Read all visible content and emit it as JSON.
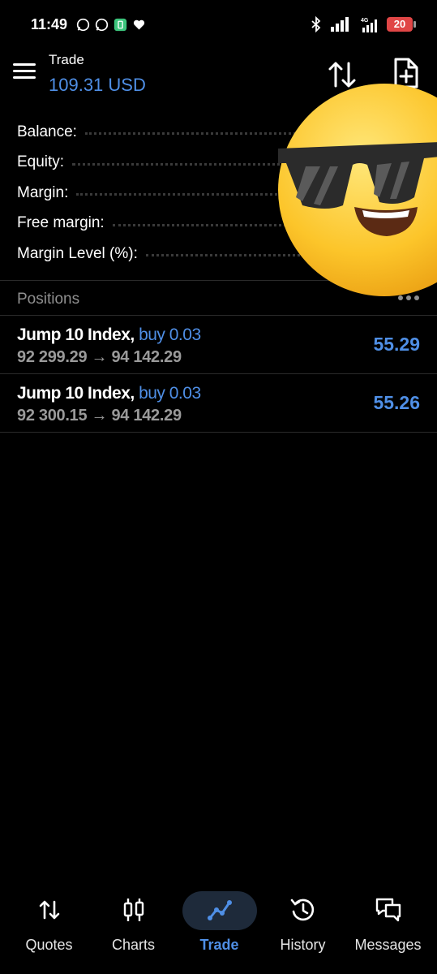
{
  "status_bar": {
    "time": "11:49",
    "battery": "20",
    "network": "4G"
  },
  "header": {
    "title": "Trade",
    "balance": "109.31 USD"
  },
  "account": [
    {
      "label": "Balance:"
    },
    {
      "label": "Equity:"
    },
    {
      "label": "Margin:"
    },
    {
      "label": "Free margin:"
    },
    {
      "label": "Margin Level (%):"
    }
  ],
  "positions": {
    "title": "Positions",
    "items": [
      {
        "symbol": "Jump 10 Index,",
        "side": "buy 0.03",
        "prices": "92 299.29 → 94 142.29",
        "profit": "55.29"
      },
      {
        "symbol": "Jump 10 Index,",
        "side": "buy 0.03",
        "prices": "92 300.15 → 94 142.29",
        "profit": "55.26"
      }
    ]
  },
  "nav": {
    "items": [
      {
        "label": "Quotes",
        "icon": "quotes-icon"
      },
      {
        "label": "Charts",
        "icon": "charts-icon"
      },
      {
        "label": "Trade",
        "icon": "trade-icon",
        "active": true
      },
      {
        "label": "History",
        "icon": "history-icon"
      },
      {
        "label": "Messages",
        "icon": "messages-icon"
      }
    ]
  },
  "colors": {
    "background": "#000000",
    "accent": "#4f8fe6",
    "muted": "#8f8f8f",
    "battery_low": "#e04646"
  }
}
